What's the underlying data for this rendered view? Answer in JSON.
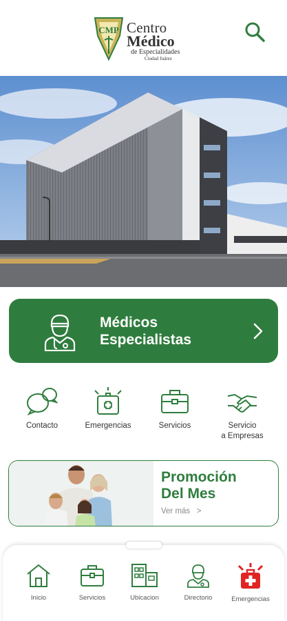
{
  "header": {
    "logo": {
      "mark": "CMP",
      "line1": "Centro",
      "line2": "Médico",
      "line3": "de Especialidades",
      "line4": "Ciudad Juárez"
    },
    "search_icon": "search-icon"
  },
  "hero": {
    "image": "hospital-building-photo"
  },
  "medicos": {
    "line1": "Médicos",
    "line2": "Especialistas",
    "icon": "doctor-icon"
  },
  "quick_actions": [
    {
      "label": "Contacto",
      "icon": "chat-bubbles-icon"
    },
    {
      "label": "Emergencias",
      "icon": "first-aid-icon"
    },
    {
      "label": "Servicios",
      "icon": "briefcase-icon"
    },
    {
      "label": "Servicio\na Empresas",
      "icon": "handshake-icon"
    }
  ],
  "promo": {
    "line1": "Promoción",
    "line2": "Del Mes",
    "link": "Ver más   >"
  },
  "bottom_nav": [
    {
      "label": "Inicio",
      "icon": "home-icon"
    },
    {
      "label": "Servicios",
      "icon": "briefcase-icon"
    },
    {
      "label": "Ubicacion",
      "icon": "building-icon"
    },
    {
      "label": "Directorio",
      "icon": "doctor-icon"
    },
    {
      "label": "Emergencias",
      "icon": "emergency-icon"
    }
  ],
  "colors": {
    "brand_green": "#2f7d3e",
    "emergency_red": "#e02424",
    "icon_green": "#2f7d3e"
  }
}
